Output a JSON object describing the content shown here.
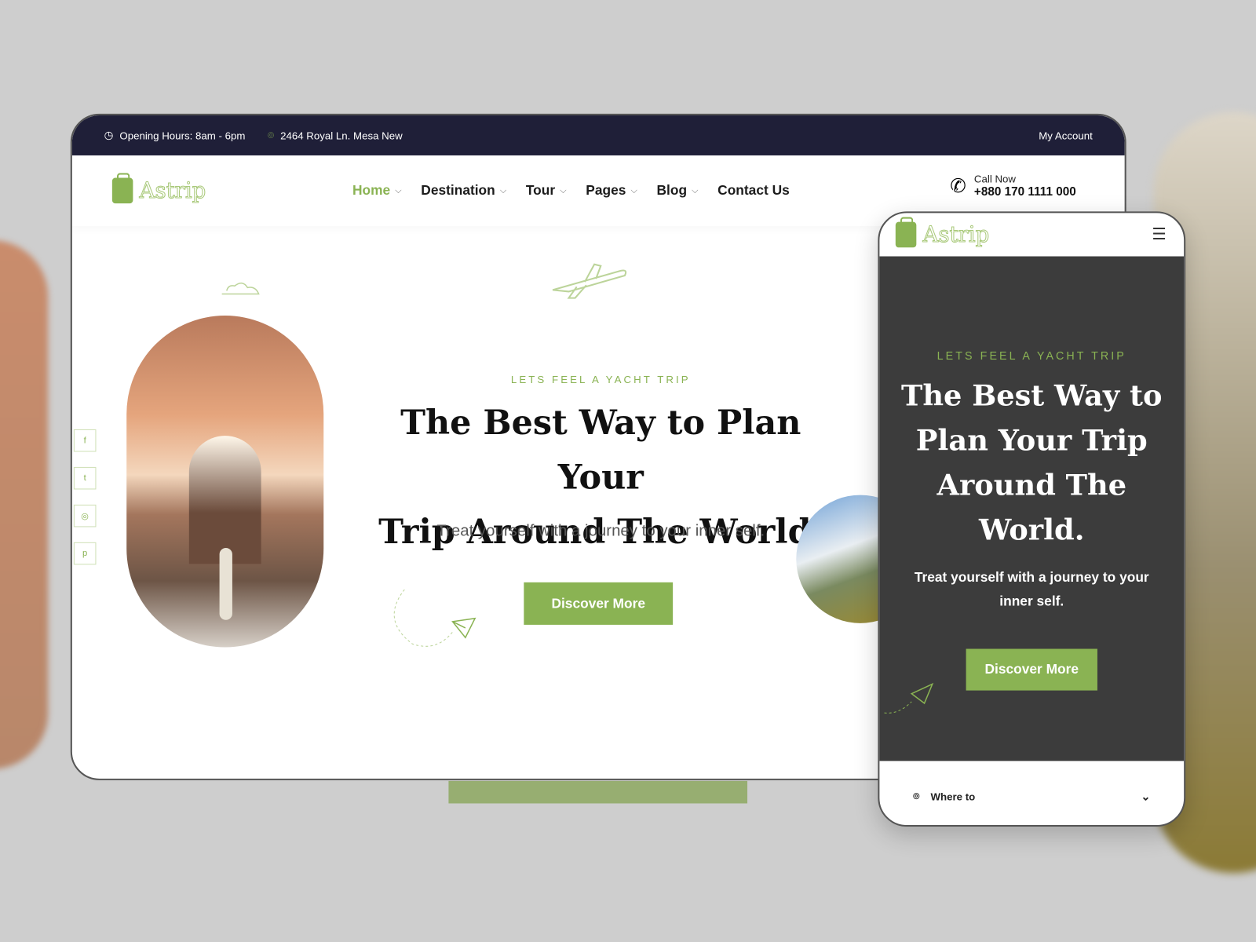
{
  "topbar": {
    "hours": "Opening Hours: 8am - 6pm",
    "address": "2464 Royal Ln. Mesa New",
    "account": "My Account"
  },
  "brand": {
    "name": "Astrip",
    "accent": "#8ab353",
    "dark": "#1f1f38"
  },
  "nav": {
    "items": [
      {
        "label": "Home",
        "active": true
      },
      {
        "label": "Destination"
      },
      {
        "label": "Tour"
      },
      {
        "label": "Pages"
      },
      {
        "label": "Blog"
      },
      {
        "label": "Contact Us"
      }
    ],
    "call_label": "Call Now",
    "phone": "+880 170 1111 000"
  },
  "social": [
    {
      "icon": "facebook-icon",
      "glyph": "f"
    },
    {
      "icon": "twitter-icon",
      "glyph": "t"
    },
    {
      "icon": "instagram-icon",
      "glyph": "◎"
    },
    {
      "icon": "pinterest-icon",
      "glyph": "p"
    }
  ],
  "hero": {
    "kicker": "LETS FEEL A YACHT TRIP",
    "title_line1": "The Best Way to Plan Your",
    "title_line2": "Trip Around The World.",
    "subtitle": "Treat yourself with a journey to your inner self.",
    "cta": "Discover More"
  },
  "mobile": {
    "kicker": "LETS FEEL A YACHT TRIP",
    "title": "The Best Way to Plan Your Trip Around The World.",
    "subtitle": "Treat yourself with a journey to your inner self.",
    "cta": "Discover More",
    "where": "Where to"
  }
}
